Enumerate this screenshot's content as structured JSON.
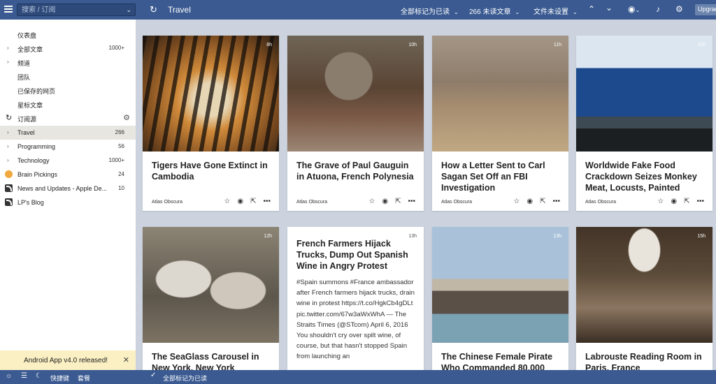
{
  "topbar": {
    "search_placeholder": "搜索 / 订阅",
    "feed_title": "Travel",
    "mark_all_read": "全部标记为已读",
    "unread_count": "266 未读文章",
    "folder_settings": "文件未设置",
    "upgrade": "Upgrade"
  },
  "sidebar": {
    "nav": [
      {
        "label": "仪表盘",
        "arrow": "",
        "count": ""
      },
      {
        "label": "全部文章",
        "arrow": "›",
        "count": "1000+"
      },
      {
        "label": "频道",
        "arrow": "›",
        "count": ""
      },
      {
        "label": "团队",
        "arrow": "",
        "count": ""
      },
      {
        "label": "已保存的网页",
        "arrow": "",
        "count": ""
      },
      {
        "label": "星标文章",
        "arrow": "",
        "count": ""
      }
    ],
    "subscriptions_label": "订阅源",
    "feeds": [
      {
        "label": "Travel",
        "count": "266",
        "arrow": "›"
      },
      {
        "label": "Programming",
        "count": "56",
        "arrow": "›"
      },
      {
        "label": "Technology",
        "count": "1000+",
        "arrow": "›"
      },
      {
        "label": "Brain Pickings",
        "count": "24",
        "arrow": ""
      },
      {
        "label": "News and Updates - Apple De...",
        "count": "10",
        "arrow": ""
      },
      {
        "label": "LP's Blog",
        "count": "",
        "arrow": ""
      }
    ],
    "banner": "Android App v4.0 released!"
  },
  "articles": [
    {
      "title": "Tigers Have Gone Extinct in Cambodia",
      "source": "Atlas Obscura",
      "age": "8h"
    },
    {
      "title": "The Grave of Paul Gauguin in Atuona, French Polynesia",
      "source": "Atlas Obscura",
      "age": "10h"
    },
    {
      "title": "How a Letter Sent to Carl Sagan Set Off an FBI Investigation",
      "source": "Atlas Obscura",
      "age": "11h"
    },
    {
      "title": "Worldwide Fake Food Crackdown Seizes Monkey Meat, Locusts, Painted",
      "source": "Atlas Obscura",
      "age": "11h"
    },
    {
      "title": "The SeaGlass Carousel in New York, New York",
      "source": "",
      "age": "12h"
    },
    {
      "title": "French Farmers Hijack Trucks, Dump Out Spanish Wine in Angry Protest",
      "source": "",
      "age": "13h",
      "body": "#Spain summons #France ambassador after French farmers hijack trucks, drain wine in protest https://t.co/HgkCb4gDLt pic.twitter.com/67w3aWxWhA — The Straits Times (@STcom) April 6, 2016 You shouldn't cry over spilt wine, of course, but that hasn't stopped Spain from launching an"
    },
    {
      "title": "The Chinese Female Pirate Who Commanded 80,000",
      "source": "",
      "age": "13h"
    },
    {
      "title": "Labrouste Reading Room in Paris, France",
      "source": "",
      "age": "15h"
    }
  ],
  "bottombar": {
    "shortcuts": "快捷键",
    "themes": "套餐",
    "mark_read": "全部标记为已读"
  }
}
